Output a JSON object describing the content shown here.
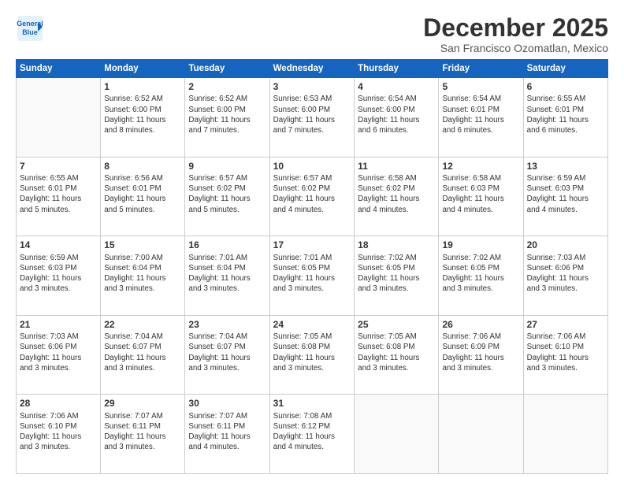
{
  "logo": {
    "line1": "General",
    "line2": "Blue"
  },
  "title": "December 2025",
  "subtitle": "San Francisco Ozomatlan, Mexico",
  "weekdays": [
    "Sunday",
    "Monday",
    "Tuesday",
    "Wednesday",
    "Thursday",
    "Friday",
    "Saturday"
  ],
  "weeks": [
    [
      {
        "day": "",
        "content": ""
      },
      {
        "day": "1",
        "content": "Sunrise: 6:52 AM\nSunset: 6:00 PM\nDaylight: 11 hours\nand 8 minutes."
      },
      {
        "day": "2",
        "content": "Sunrise: 6:52 AM\nSunset: 6:00 PM\nDaylight: 11 hours\nand 7 minutes."
      },
      {
        "day": "3",
        "content": "Sunrise: 6:53 AM\nSunset: 6:00 PM\nDaylight: 11 hours\nand 7 minutes."
      },
      {
        "day": "4",
        "content": "Sunrise: 6:54 AM\nSunset: 6:00 PM\nDaylight: 11 hours\nand 6 minutes."
      },
      {
        "day": "5",
        "content": "Sunrise: 6:54 AM\nSunset: 6:01 PM\nDaylight: 11 hours\nand 6 minutes."
      },
      {
        "day": "6",
        "content": "Sunrise: 6:55 AM\nSunset: 6:01 PM\nDaylight: 11 hours\nand 6 minutes."
      }
    ],
    [
      {
        "day": "7",
        "content": "Sunrise: 6:55 AM\nSunset: 6:01 PM\nDaylight: 11 hours\nand 5 minutes."
      },
      {
        "day": "8",
        "content": "Sunrise: 6:56 AM\nSunset: 6:01 PM\nDaylight: 11 hours\nand 5 minutes."
      },
      {
        "day": "9",
        "content": "Sunrise: 6:57 AM\nSunset: 6:02 PM\nDaylight: 11 hours\nand 5 minutes."
      },
      {
        "day": "10",
        "content": "Sunrise: 6:57 AM\nSunset: 6:02 PM\nDaylight: 11 hours\nand 4 minutes."
      },
      {
        "day": "11",
        "content": "Sunrise: 6:58 AM\nSunset: 6:02 PM\nDaylight: 11 hours\nand 4 minutes."
      },
      {
        "day": "12",
        "content": "Sunrise: 6:58 AM\nSunset: 6:03 PM\nDaylight: 11 hours\nand 4 minutes."
      },
      {
        "day": "13",
        "content": "Sunrise: 6:59 AM\nSunset: 6:03 PM\nDaylight: 11 hours\nand 4 minutes."
      }
    ],
    [
      {
        "day": "14",
        "content": "Sunrise: 6:59 AM\nSunset: 6:03 PM\nDaylight: 11 hours\nand 3 minutes."
      },
      {
        "day": "15",
        "content": "Sunrise: 7:00 AM\nSunset: 6:04 PM\nDaylight: 11 hours\nand 3 minutes."
      },
      {
        "day": "16",
        "content": "Sunrise: 7:01 AM\nSunset: 6:04 PM\nDaylight: 11 hours\nand 3 minutes."
      },
      {
        "day": "17",
        "content": "Sunrise: 7:01 AM\nSunset: 6:05 PM\nDaylight: 11 hours\nand 3 minutes."
      },
      {
        "day": "18",
        "content": "Sunrise: 7:02 AM\nSunset: 6:05 PM\nDaylight: 11 hours\nand 3 minutes."
      },
      {
        "day": "19",
        "content": "Sunrise: 7:02 AM\nSunset: 6:05 PM\nDaylight: 11 hours\nand 3 minutes."
      },
      {
        "day": "20",
        "content": "Sunrise: 7:03 AM\nSunset: 6:06 PM\nDaylight: 11 hours\nand 3 minutes."
      }
    ],
    [
      {
        "day": "21",
        "content": "Sunrise: 7:03 AM\nSunset: 6:06 PM\nDaylight: 11 hours\nand 3 minutes."
      },
      {
        "day": "22",
        "content": "Sunrise: 7:04 AM\nSunset: 6:07 PM\nDaylight: 11 hours\nand 3 minutes."
      },
      {
        "day": "23",
        "content": "Sunrise: 7:04 AM\nSunset: 6:07 PM\nDaylight: 11 hours\nand 3 minutes."
      },
      {
        "day": "24",
        "content": "Sunrise: 7:05 AM\nSunset: 6:08 PM\nDaylight: 11 hours\nand 3 minutes."
      },
      {
        "day": "25",
        "content": "Sunrise: 7:05 AM\nSunset: 6:08 PM\nDaylight: 11 hours\nand 3 minutes."
      },
      {
        "day": "26",
        "content": "Sunrise: 7:06 AM\nSunset: 6:09 PM\nDaylight: 11 hours\nand 3 minutes."
      },
      {
        "day": "27",
        "content": "Sunrise: 7:06 AM\nSunset: 6:10 PM\nDaylight: 11 hours\nand 3 minutes."
      }
    ],
    [
      {
        "day": "28",
        "content": "Sunrise: 7:06 AM\nSunset: 6:10 PM\nDaylight: 11 hours\nand 3 minutes."
      },
      {
        "day": "29",
        "content": "Sunrise: 7:07 AM\nSunset: 6:11 PM\nDaylight: 11 hours\nand 3 minutes."
      },
      {
        "day": "30",
        "content": "Sunrise: 7:07 AM\nSunset: 6:11 PM\nDaylight: 11 hours\nand 4 minutes."
      },
      {
        "day": "31",
        "content": "Sunrise: 7:08 AM\nSunset: 6:12 PM\nDaylight: 11 hours\nand 4 minutes."
      },
      {
        "day": "",
        "content": ""
      },
      {
        "day": "",
        "content": ""
      },
      {
        "day": "",
        "content": ""
      }
    ]
  ]
}
